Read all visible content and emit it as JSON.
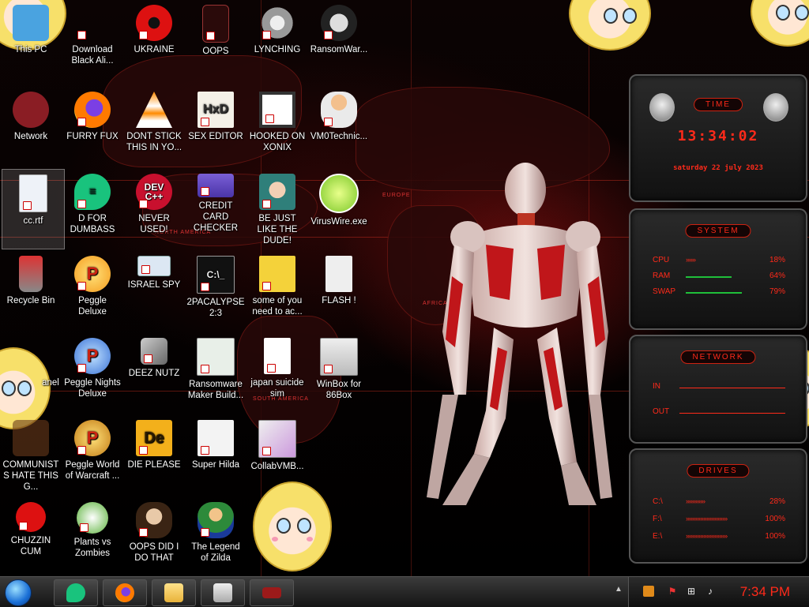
{
  "desktop": {
    "map_labels": [
      "NORTH AMERICA",
      "EUROPE",
      "AFRICA",
      "SOUTH AMERICA"
    ],
    "icons": [
      {
        "label": "This PC"
      },
      {
        "label": "Download Black Ali..."
      },
      {
        "label": "UKRAINE"
      },
      {
        "label": "OOPS"
      },
      {
        "label": "LYNCHING"
      },
      {
        "label": "RansomWar..."
      },
      {
        "label": "Network"
      },
      {
        "label": "FURRY FUX"
      },
      {
        "label": "DONT STICK THIS IN YO..."
      },
      {
        "label": "SEX EDITOR"
      },
      {
        "label": "HOOKED ON XONIX"
      },
      {
        "label": "VM0Technic..."
      },
      {
        "label": "cc.rtf"
      },
      {
        "label": "D FOR DUMBASS"
      },
      {
        "label": "NEVER USED!"
      },
      {
        "label": "CREDIT CARD CHECKER"
      },
      {
        "label": "BE JUST LIKE THE DUDE!"
      },
      {
        "label": "VirusWire.exe"
      },
      {
        "label": "Recycle Bin"
      },
      {
        "label": "Peggle Deluxe"
      },
      {
        "label": "ISRAEL SPY"
      },
      {
        "label": "2PACALYPSE 2:3"
      },
      {
        "label": "some of you need to ac..."
      },
      {
        "label": "FLASH !"
      },
      {
        "label": "anel"
      },
      {
        "label": "Peggle Nights Deluxe"
      },
      {
        "label": "DEEZ NUTZ"
      },
      {
        "label": "Ransomware Maker Build..."
      },
      {
        "label": "japan suicide sim"
      },
      {
        "label": "WinBox for 86Box"
      },
      {
        "label": "COMMUNISTS HATE THIS G..."
      },
      {
        "label": "Peggle World of Warcraft ..."
      },
      {
        "label": "DIE PLEASE"
      },
      {
        "label": "Super Hilda"
      },
      {
        "label": "CollabVMB..."
      },
      {
        "label": "CHUZZIN CUM"
      },
      {
        "label": "Plants vs Zombies"
      },
      {
        "label": "OOPS DID I DO THAT"
      },
      {
        "label": "The Legend of Zilda"
      }
    ]
  },
  "widgets": {
    "time": {
      "title": "TIME",
      "clock": "13:34:02",
      "date": "saturday 22 july 2023"
    },
    "system": {
      "title": "SYSTEM",
      "rows": [
        {
          "key": "CPU",
          "value": "18%",
          "level": 0.18,
          "arrows": "»»»"
        },
        {
          "key": "RAM",
          "value": "64%",
          "level": 0.64
        },
        {
          "key": "SWAP",
          "value": "79%",
          "level": 0.79
        }
      ]
    },
    "network": {
      "title": "NETWORK",
      "in_label": "IN",
      "out_label": "OUT"
    },
    "drives": {
      "title": "DRIVES",
      "rows": [
        {
          "key": "C:\\",
          "value": "28%",
          "arrows": "»»»»»»"
        },
        {
          "key": "F:\\",
          "value": "100%",
          "arrows": "»»»»»»»»»»»»»"
        },
        {
          "key": "E:\\",
          "value": "100%",
          "arrows": "»»»»»»»»»»»»»"
        }
      ]
    }
  },
  "taskbar": {
    "clock": "7:34 PM",
    "apps": [
      "green-d-app",
      "firefox",
      "file-explorer",
      "winbox",
      "red-app"
    ]
  },
  "colors": {
    "accent_red": "#ff2a1a",
    "taskbar_bg": "#222222",
    "start_blue": "#1a6fd6"
  }
}
